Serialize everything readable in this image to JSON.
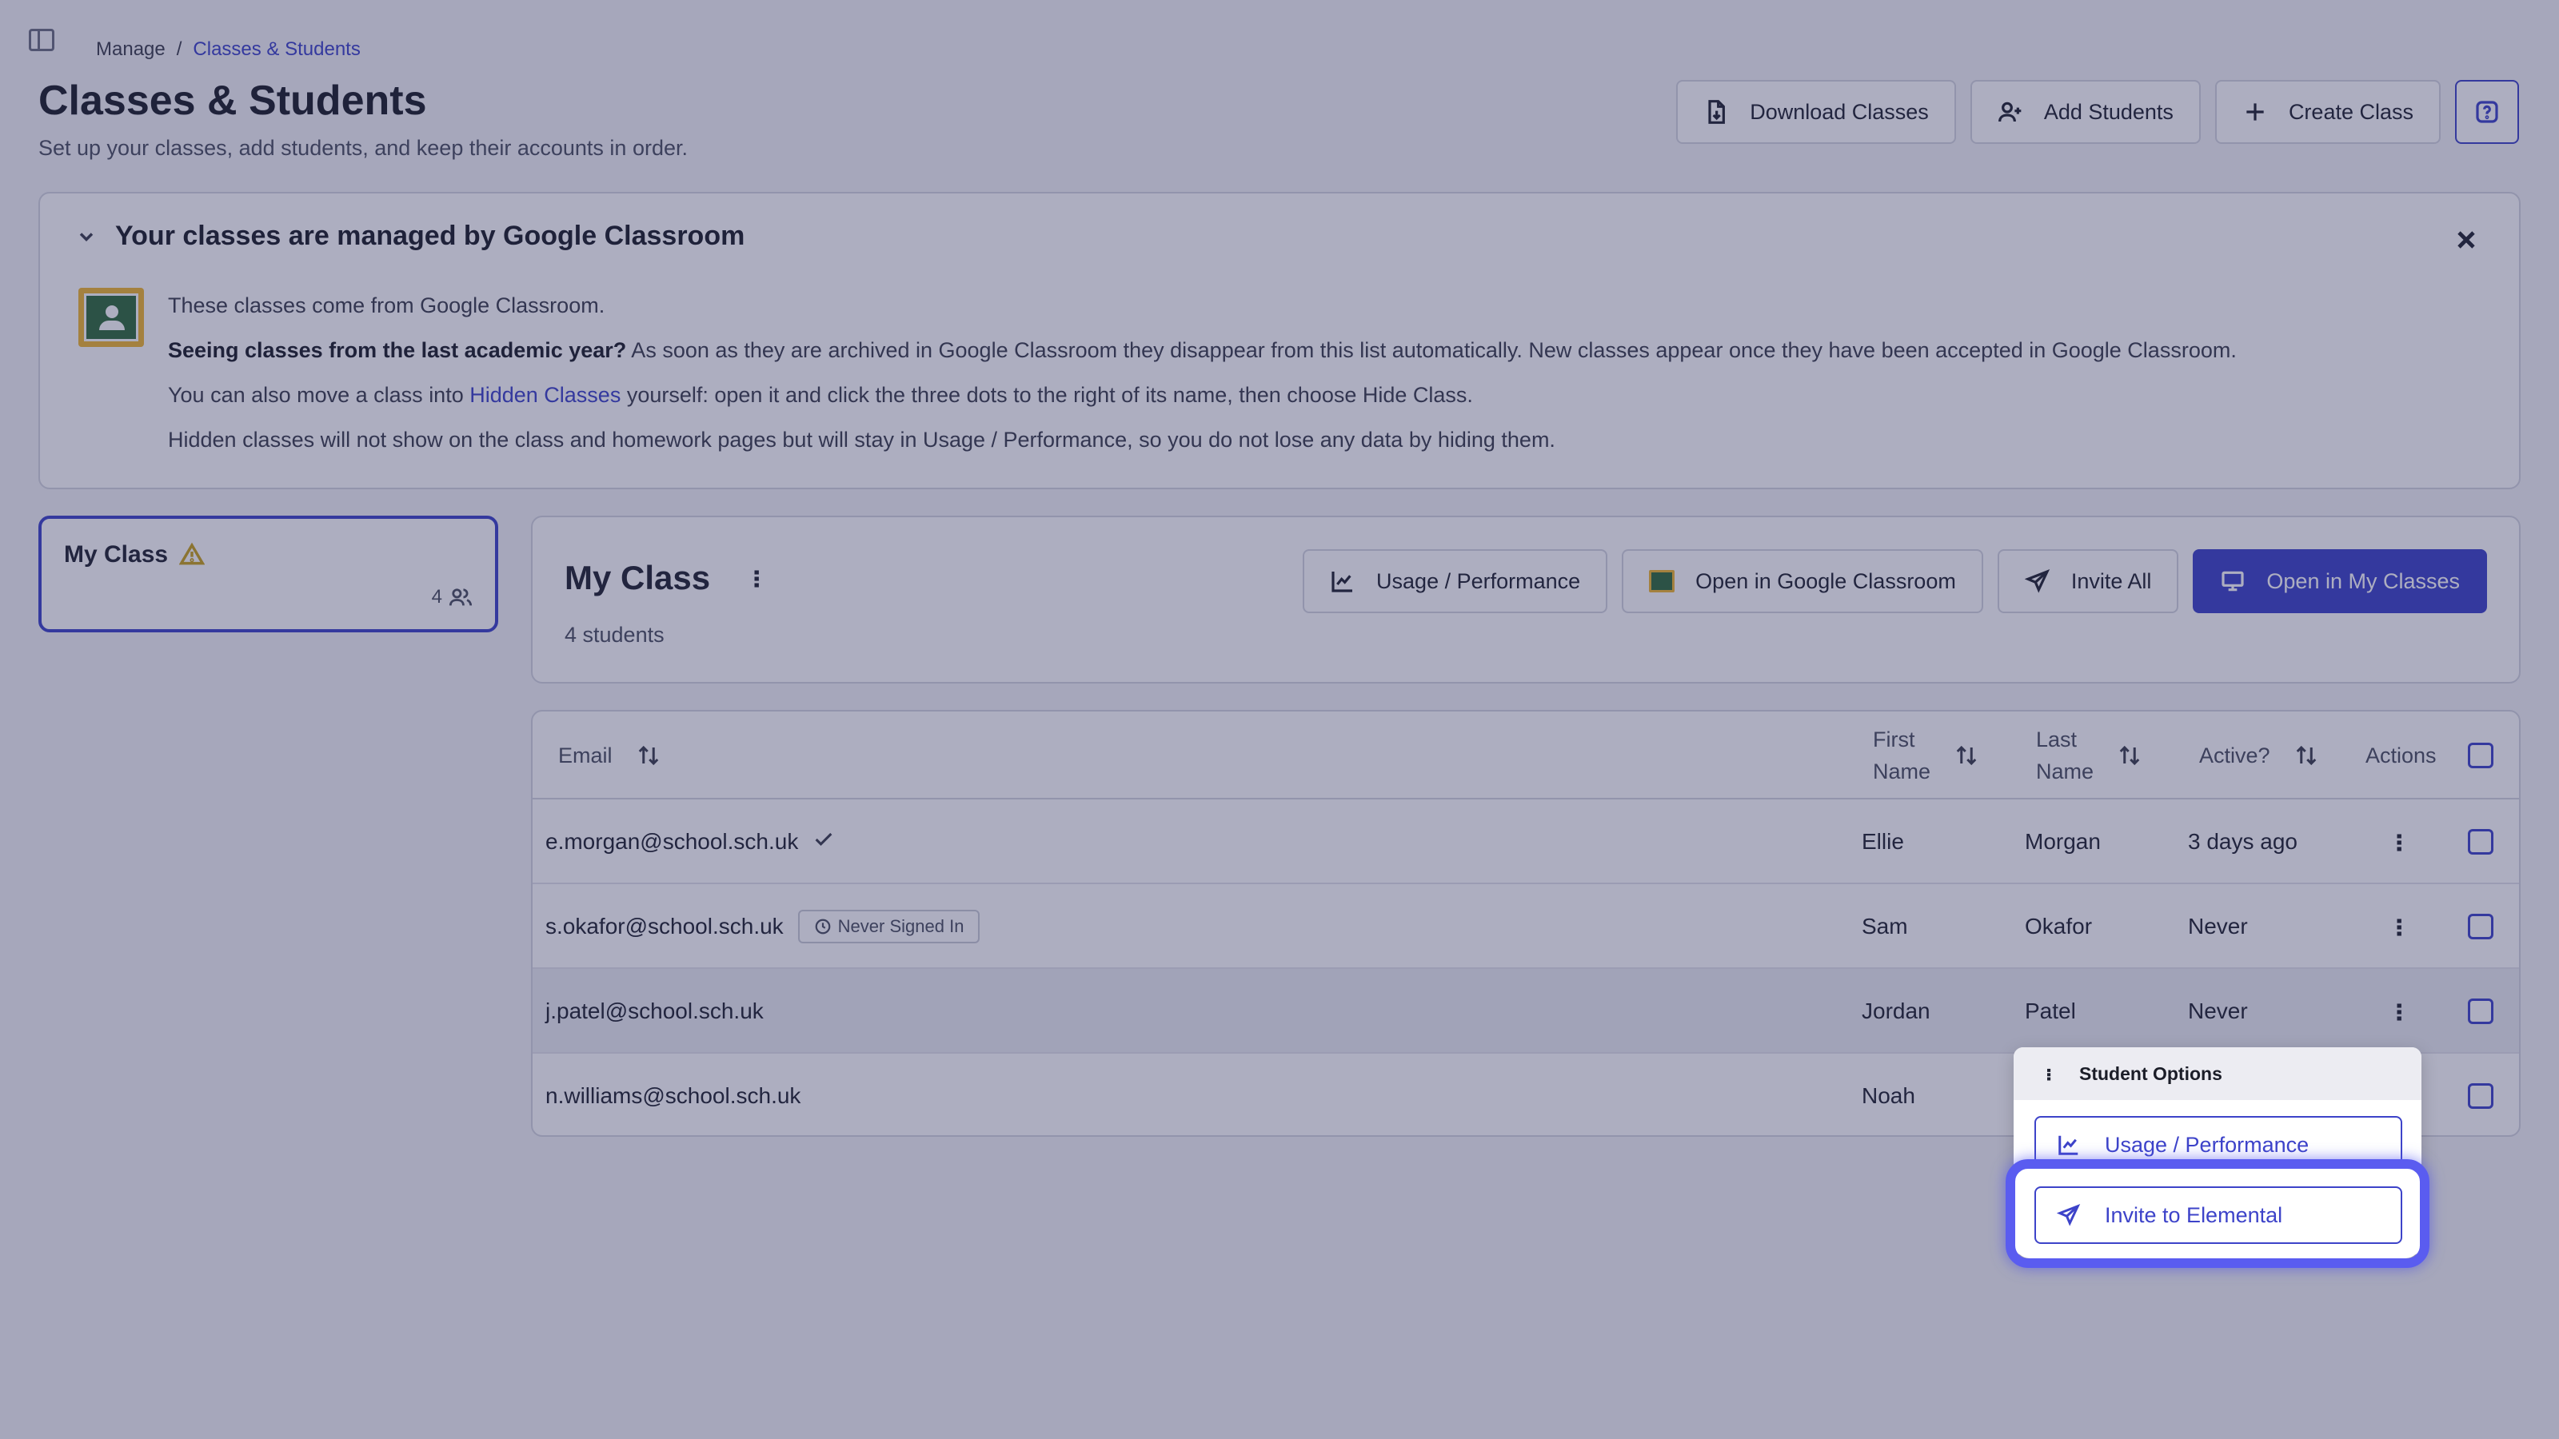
{
  "breadcrumb": {
    "root": "Manage",
    "separator": "/",
    "current": "Classes & Students"
  },
  "page": {
    "title": "Classes & Students",
    "subtitle": "Set up your classes, add students, and keep their accounts in order."
  },
  "header_actions": {
    "download": "Download Classes",
    "add_students": "Add Students",
    "create_class": "Create Class"
  },
  "notice": {
    "title": "Your classes are managed by Google Classroom",
    "line1": "These classes come from Google Classroom.",
    "line2_bold": "Seeing classes from the last academic year?",
    "line2_rest": " As soon as they are archived in Google Classroom they disappear from this list automatically. New classes appear once they have been accepted in Google Classroom.",
    "line3_pre": "You can also move a class into ",
    "line3_link": "Hidden Classes",
    "line3_post": " yourself: open it and click the three dots to the right of its name, then choose Hide Class.",
    "line4": "Hidden classes will not show on the class and homework pages but will stay in Usage / Performance, so you do not lose any data by hiding them."
  },
  "class_card": {
    "name": "My Class",
    "count": "4"
  },
  "class_panel": {
    "title": "My Class",
    "subtitle": "4 students",
    "actions": {
      "usage": "Usage / Performance",
      "open_gc": "Open in Google Classroom",
      "invite_all": "Invite All",
      "open_my_classes": "Open in My Classes"
    }
  },
  "table": {
    "headers": {
      "email": "Email",
      "first_name_1": "First",
      "first_name_2": "Name",
      "last_name_1": "Last",
      "last_name_2": "Name",
      "active": "Active?",
      "actions": "Actions"
    },
    "rows": [
      {
        "email": "e.morgan@school.sch.uk",
        "first": "Ellie",
        "last": "Morgan",
        "active": "3 days ago",
        "badge": ""
      },
      {
        "email": "s.okafor@school.sch.uk",
        "first": "Sam",
        "last": "Okafor",
        "active": "Never",
        "badge": "Never Signed In"
      },
      {
        "email": "j.patel@school.sch.uk",
        "first": "Jordan",
        "last": "Patel",
        "active": "Never",
        "badge": ""
      },
      {
        "email": "n.williams@school.sch.uk",
        "first": "Noah",
        "last": "",
        "active": "",
        "badge": ""
      }
    ]
  },
  "menu": {
    "title": "Student Options",
    "usage": "Usage / Performance",
    "invite": "Invite to Elemental"
  },
  "colors": {
    "accent": "#3d43c9",
    "highlight": "#5a5cf0",
    "warning": "#c9a21a"
  }
}
